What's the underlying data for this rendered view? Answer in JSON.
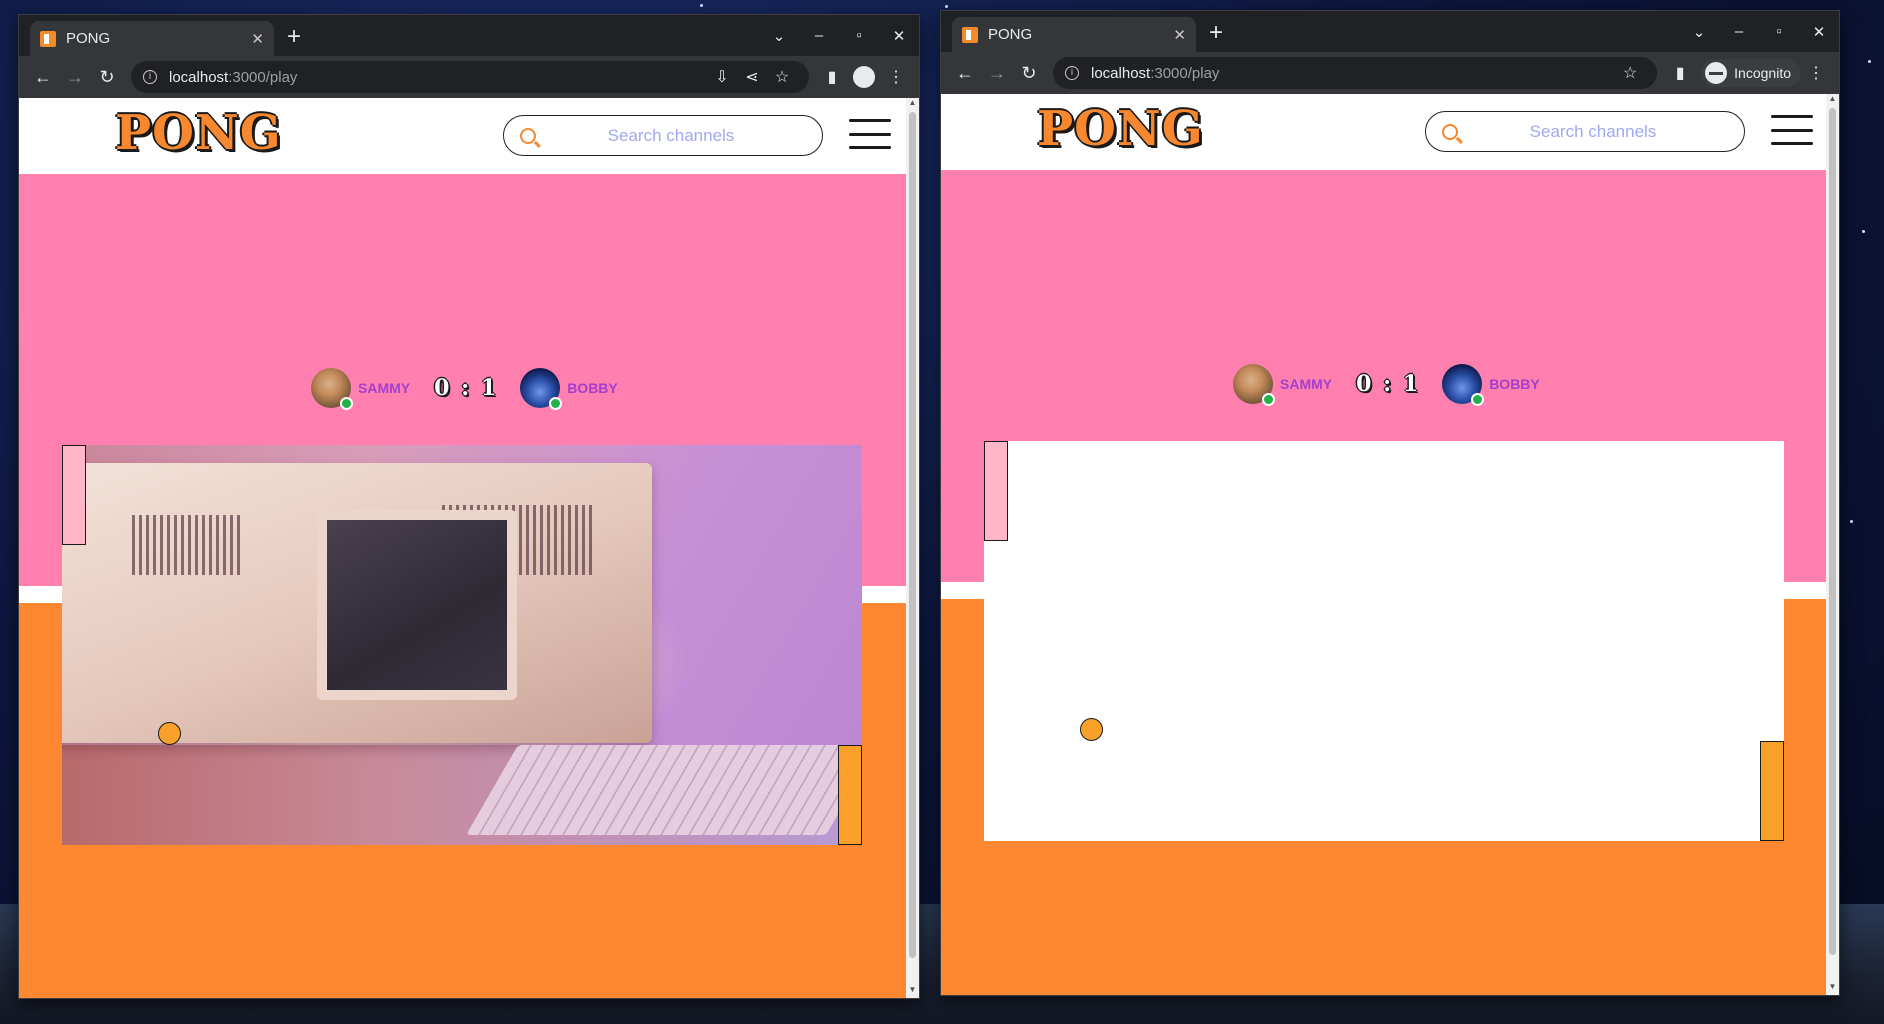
{
  "windows": [
    {
      "tab": {
        "title": "PONG"
      },
      "address": {
        "host": "localhost",
        "path": ":3000/play"
      },
      "incognito": false,
      "site": {
        "logo": "PONG",
        "search_placeholder": "Search channels",
        "player1": {
          "name": "SAMMY",
          "status": "online"
        },
        "player2": {
          "name": "BOBBY",
          "status": "online"
        },
        "score": "0 : 1",
        "court_background": "retro-computer-photo"
      }
    },
    {
      "tab": {
        "title": "PONG"
      },
      "address": {
        "host": "localhost",
        "path": ":3000/play"
      },
      "incognito": true,
      "incognito_label": "Incognito",
      "site": {
        "logo": "PONG",
        "search_placeholder": "Search channels",
        "player1": {
          "name": "SAMMY",
          "status": "online"
        },
        "player2": {
          "name": "BOBBY",
          "status": "online"
        },
        "score": "0 : 1",
        "court_background": "blank"
      }
    }
  ],
  "colors": {
    "accent_orange": "#fe8731",
    "accent_pink": "#ff80ae",
    "player_name": "#a23fd0",
    "search_placeholder": "#9fa9f2",
    "online_status": "#25b14a",
    "ball": "#f8a02a",
    "left_paddle": "#ffb6c9",
    "right_paddle": "#f8a02a"
  },
  "icons": {
    "tab_favicon": "pong-favicon",
    "tab_close": "close-icon",
    "new_tab": "plus-icon",
    "back": "back-arrow-icon",
    "forward": "forward-arrow-icon",
    "reload": "reload-icon",
    "site_info": "info-icon",
    "install": "install-app-icon",
    "share": "share-icon",
    "bookmark": "star-icon",
    "side_panel": "side-panel-icon",
    "profile": "profile-icon",
    "menu": "kebab-menu-icon",
    "search": "search-icon",
    "hamburger": "hamburger-menu-icon"
  }
}
